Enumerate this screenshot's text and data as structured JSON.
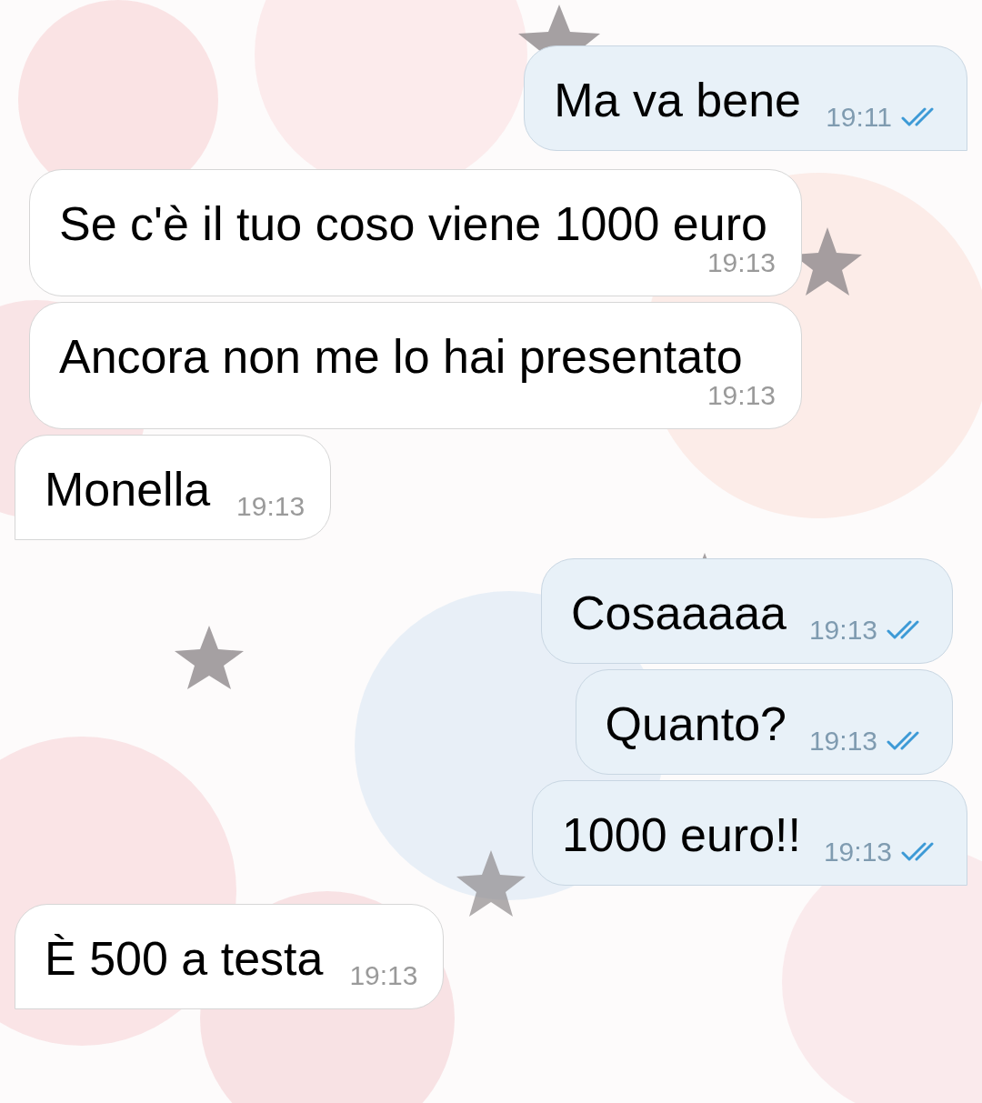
{
  "messages": [
    {
      "kind": "outgoing",
      "text": "Ma va bene",
      "time": "19:11",
      "read": true,
      "tail": true
    },
    {
      "kind": "incoming",
      "text": "Se c'è il tuo coso viene 1000 euro",
      "time": "19:13",
      "tail": false
    },
    {
      "kind": "incoming",
      "text": "Ancora non me lo hai presentato",
      "time": "19:13",
      "tail": false
    },
    {
      "kind": "incoming",
      "text": "Monella",
      "time": "19:13",
      "tail": true
    },
    {
      "kind": "outgoing",
      "text": "Cosaaaaa",
      "time": "19:13",
      "read": true,
      "tail": false
    },
    {
      "kind": "outgoing",
      "text": "Quanto?",
      "time": "19:13",
      "read": true,
      "tail": false
    },
    {
      "kind": "outgoing",
      "text": "1000 euro!!",
      "time": "19:13",
      "read": true,
      "tail": true
    },
    {
      "kind": "incoming",
      "text": "È 500 a testa",
      "time": "19:13",
      "tail": true
    }
  ]
}
